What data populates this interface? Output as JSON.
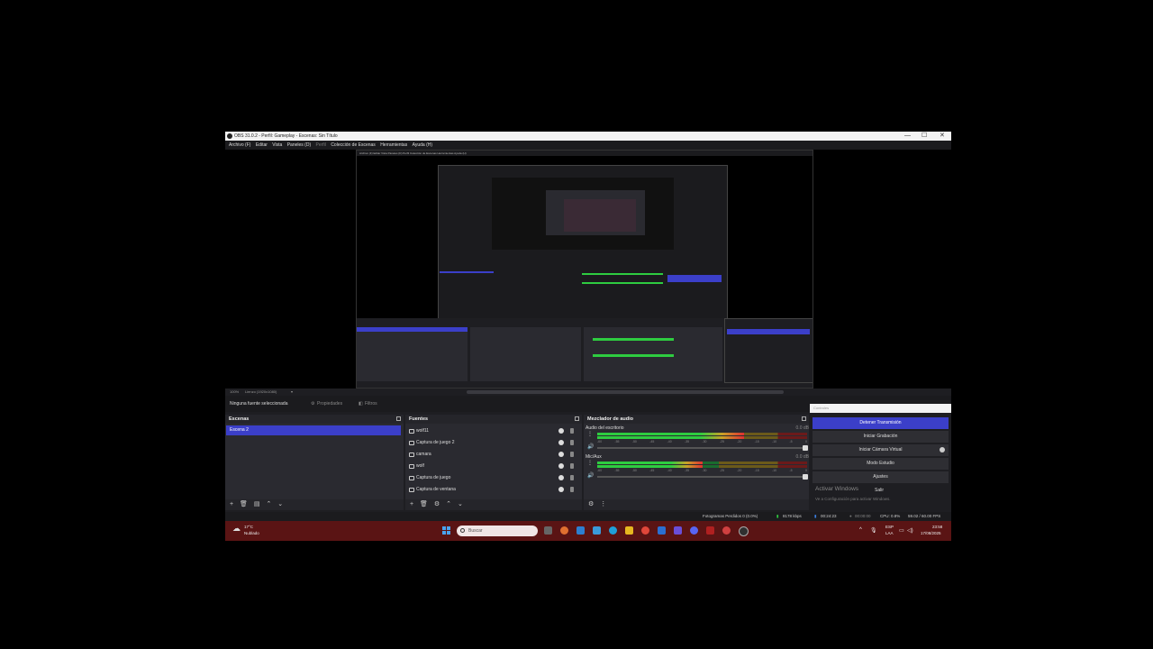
{
  "window": {
    "title": "OBS 31.0.2 - Perfil: Gameplay - Escenas: Sin Título",
    "controls": [
      "—",
      "☐",
      "✕"
    ]
  },
  "menu": [
    "Archivo (F)",
    "Editar",
    "Vista",
    "Paneles (D)",
    "Perfil",
    "Colección de Escenas",
    "Herramientas",
    "Ayuda (H)"
  ],
  "preview": {
    "zoom": "100%",
    "canvas_mode": "Lienzo (1920x1080)"
  },
  "properties_bar": {
    "no_source": "Ninguna fuente seleccionada",
    "properties": "Propiedades",
    "filters": "Filtros"
  },
  "scenes": {
    "title": "Escenas",
    "items": [
      "Escena 2"
    ]
  },
  "sources": {
    "title": "Fuentes",
    "items": [
      "wolf11",
      "Captura de juego 2",
      "camara",
      "wolf",
      "Captura de juego",
      "Captura de ventana"
    ]
  },
  "mixer": {
    "title": "Mezclador de audio",
    "channels": [
      {
        "name": "Audio del escritorio",
        "db": "0.0 dB",
        "level": 0.7
      },
      {
        "name": "Mic/Aux",
        "db": "0.0 dB",
        "level": 0.5
      }
    ],
    "ticks": [
      "-60",
      "-55",
      "-50",
      "-45",
      "-40",
      "-35",
      "-30",
      "-25",
      "-20",
      "-15",
      "-10",
      "-5",
      "0"
    ]
  },
  "controls": {
    "title": "Controles",
    "buttons": [
      "Detener Transmisión",
      "Iniciar Grabación",
      "Iniciar Cámara Virtual",
      "Modo Estudio",
      "Ajustes"
    ],
    "exit": "Salir",
    "activate_windows": "Activar Windows",
    "activate_windows_sub": "Ve a Configuración para activar Windows."
  },
  "status": {
    "dropped_frames": "Fotogramas Perdidos 0 (0.0%)",
    "bitrate": "8178 kbps",
    "stream_time": "00:24:23",
    "rec_time": "00:00:00",
    "cpu": "CPU: 0.8%",
    "fps": "59.02 / 60.00 FPS"
  },
  "taskbar": {
    "weather_temp": "17°C",
    "weather_desc": "Nublado",
    "search": "Buscar",
    "lang": "ESP",
    "lang2": "LAA",
    "time": "23:58",
    "date": "17/08/2025"
  }
}
